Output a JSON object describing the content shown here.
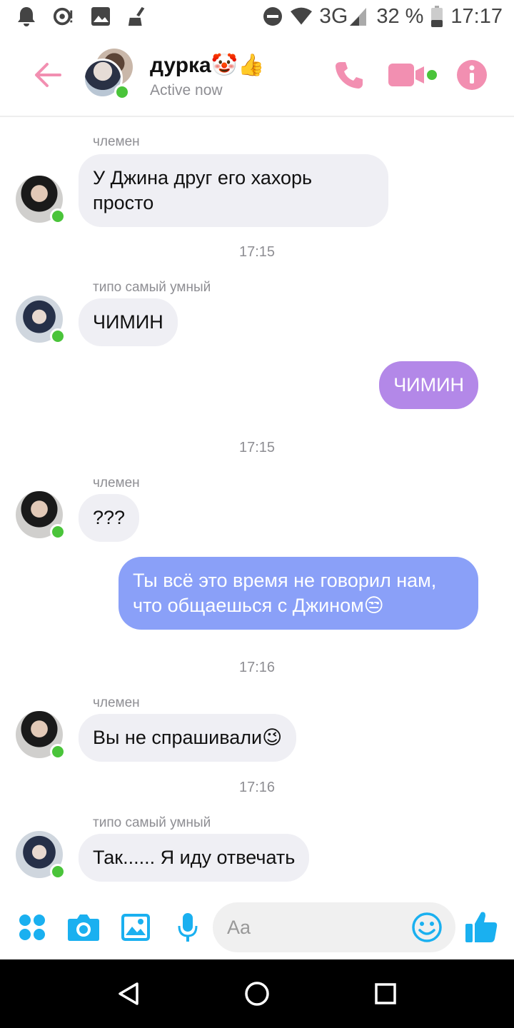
{
  "status_bar": {
    "network": "3G",
    "battery": "32 %",
    "time": "17:17"
  },
  "header": {
    "title": "дурка🤡👍",
    "subtitle": "Active now"
  },
  "messages": [
    {
      "sender": "члемен",
      "text": "У Джина друг его хахорь\nпросто"
    },
    {
      "time": "17:15"
    },
    {
      "sender": "типо самый умный",
      "text": "ЧИМИН"
    },
    {
      "text": "ЧИМИН"
    },
    {
      "time": "17:15"
    },
    {
      "sender": "члемен",
      "text": "???"
    },
    {
      "text": "Ты всё это время не говорил нам,\nчто общаешься с Джином😒"
    },
    {
      "time": "17:16"
    },
    {
      "sender": "члемен",
      "text": "Вы не спрашивали😉"
    },
    {
      "time": "17:16"
    },
    {
      "sender": "типо самый умный",
      "text": "Так...... Я иду отвечать"
    }
  ],
  "composer": {
    "placeholder": "Aa"
  },
  "colors": {
    "accent": "#f28fb1",
    "online": "#4ac43a",
    "out_bubble_1": "#b388e8",
    "out_bubble_2": "#8aa0f8",
    "composer_icons": "#1ab0f0"
  }
}
